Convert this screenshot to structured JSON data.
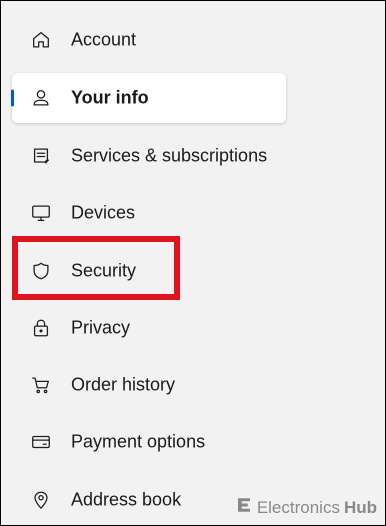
{
  "sidebar": {
    "items": [
      {
        "label": "Account",
        "icon": "home-icon"
      },
      {
        "label": "Your info",
        "icon": "person-icon",
        "selected": true
      },
      {
        "label": "Services & subscriptions",
        "icon": "subscriptions-icon"
      },
      {
        "label": "Devices",
        "icon": "monitor-icon"
      },
      {
        "label": "Security",
        "icon": "shield-icon",
        "highlighted": true
      },
      {
        "label": "Privacy",
        "icon": "lock-icon"
      },
      {
        "label": "Order history",
        "icon": "cart-icon"
      },
      {
        "label": "Payment options",
        "icon": "credit-card-icon"
      },
      {
        "label": "Address book",
        "icon": "location-pin-icon"
      }
    ]
  },
  "colors": {
    "accent": "#005fb8",
    "highlight": "#e0141e",
    "background": "#f2f2f2"
  },
  "watermark": {
    "brand": "Electronics",
    "suffix": "Hub"
  }
}
